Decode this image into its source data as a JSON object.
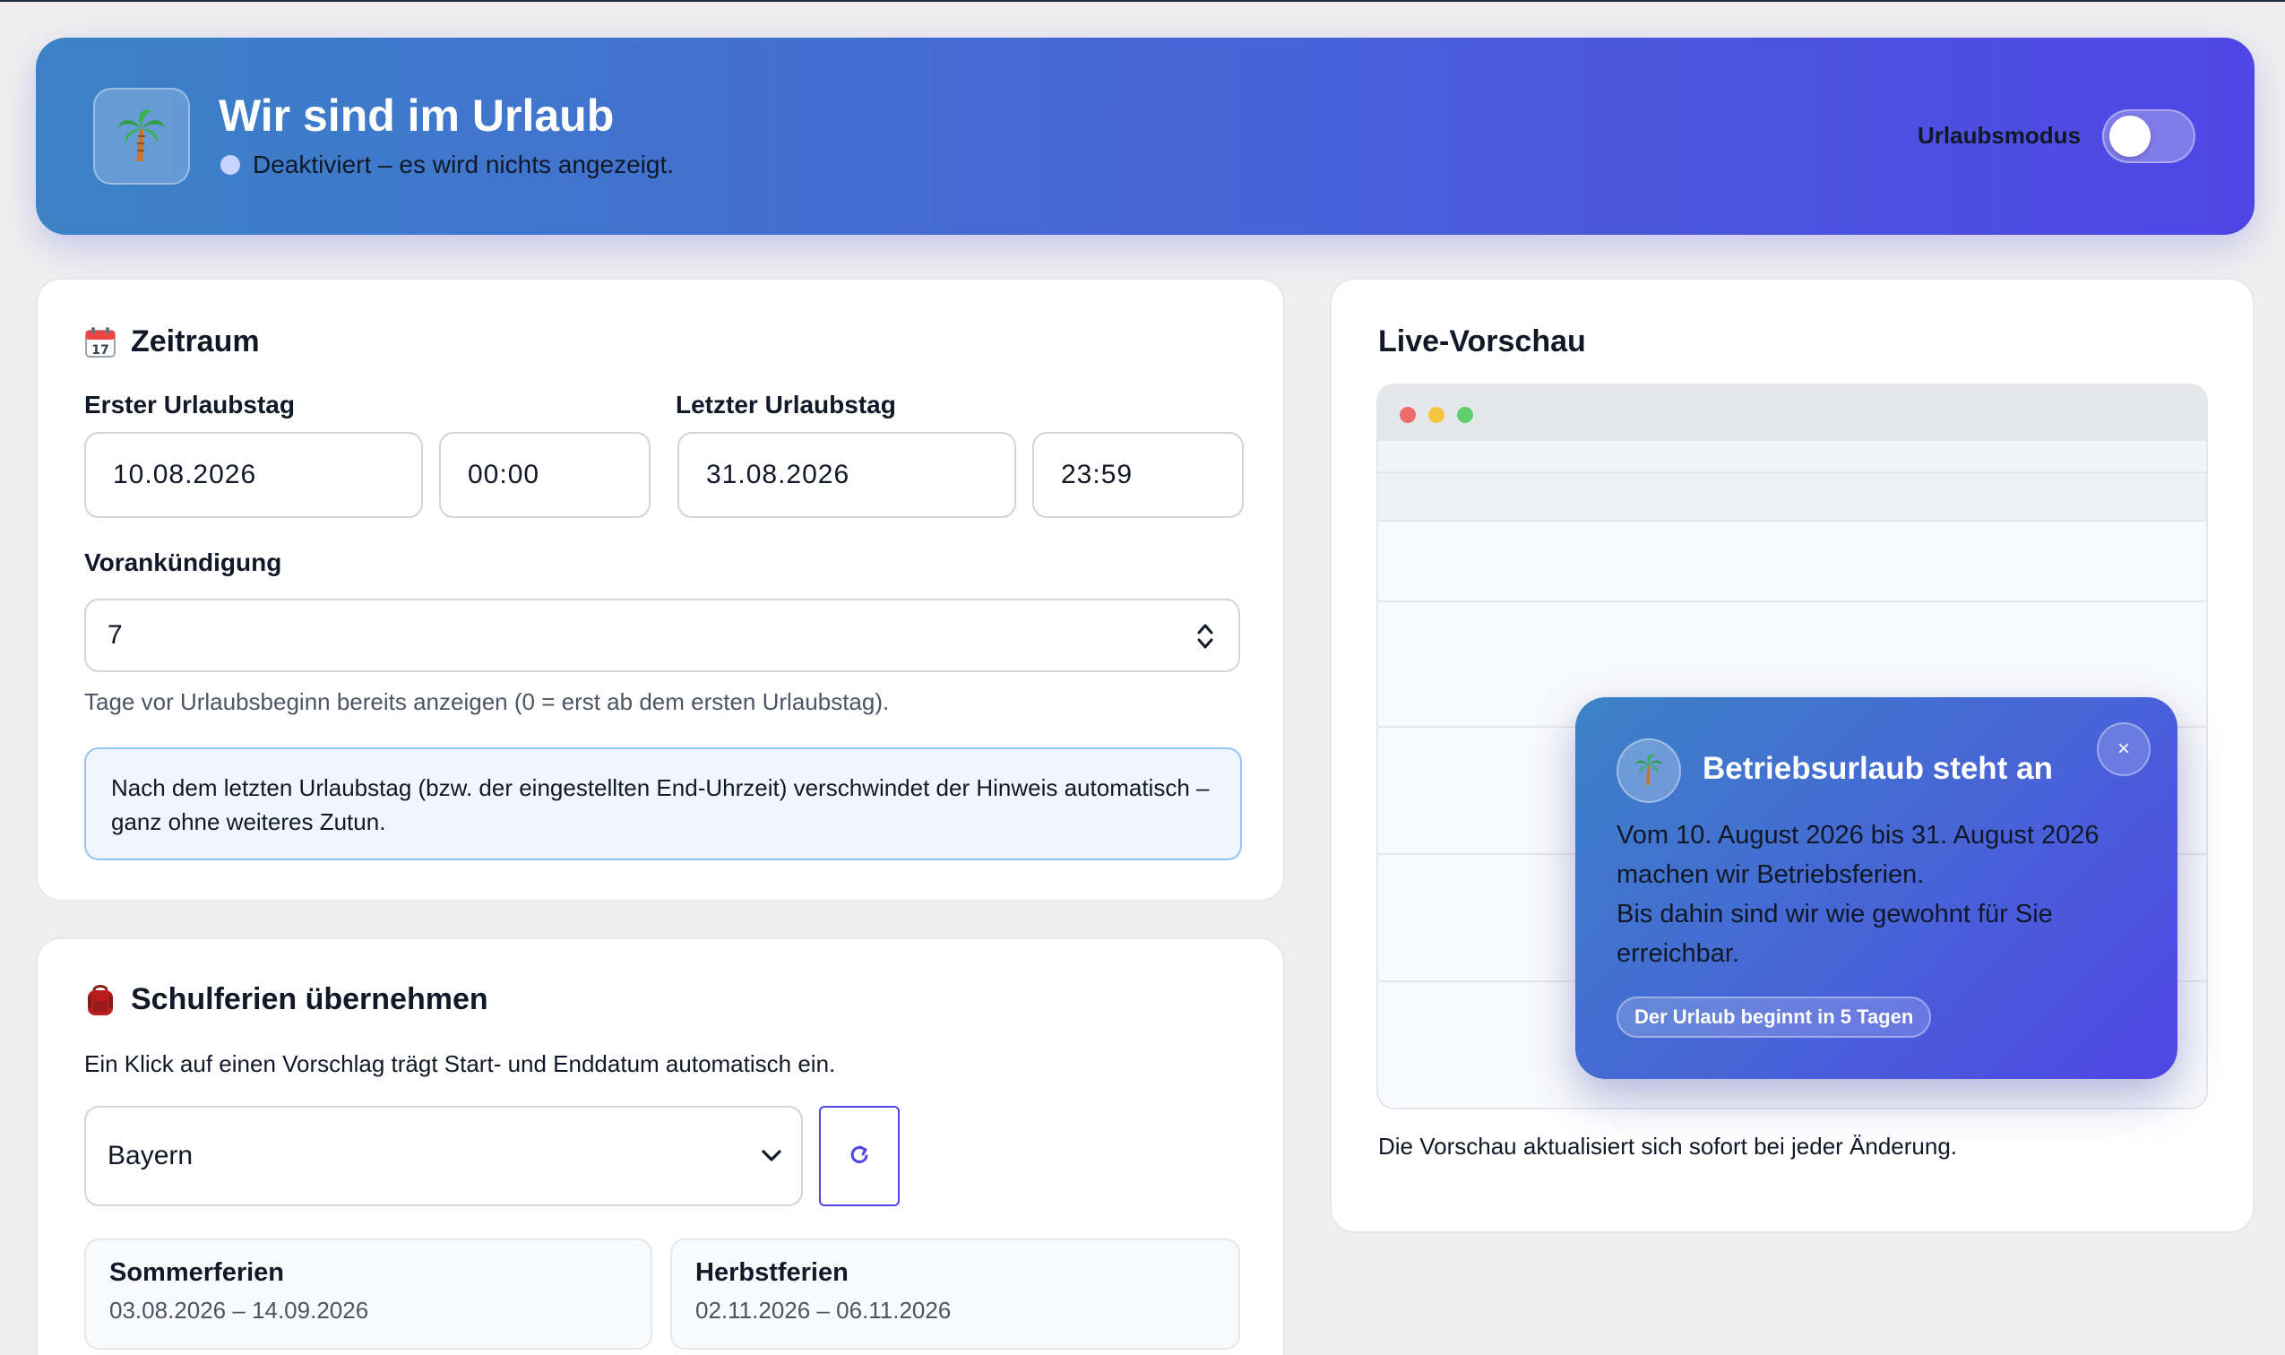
{
  "header": {
    "title": "Wir sind im Urlaub",
    "status": "Deaktiviert – es wird nichts angezeigt.",
    "toggle_label": "Urlaubsmodus",
    "toggle_on": false,
    "logo_icon": "palm-tree-icon"
  },
  "period": {
    "title": "Zeitraum",
    "icon": "calendar-icon",
    "first_day_label": "Erster Urlaubstag",
    "first_day_date": "10.08.2026",
    "first_day_time": "00:00",
    "last_day_label": "Letzter Urlaubstag",
    "last_day_date": "31.08.2026",
    "last_day_time": "23:59",
    "notice_label": "Vorankündigung",
    "notice_value": "7",
    "notice_hint": "Tage vor Urlaubsbeginn bereits anzeigen (0 = erst ab dem ersten Urlaubstag).",
    "info_text": "Nach dem letzten Urlaubstag (bzw. der eingestellten End-Uhrzeit) verschwindet der Hinweis automatisch – ganz ohne weiteres Zutun."
  },
  "school": {
    "title": "Schulferien übernehmen",
    "icon": "school-bag-icon",
    "description": "Ein Klick auf einen Vorschlag trägt Start- und Enddatum automatisch ein.",
    "state_selected": "Bayern",
    "holidays": [
      {
        "name": "Sommerferien",
        "range": "03.08.2026 – 14.09.2026"
      },
      {
        "name": "Herbstferien",
        "range": "02.11.2026 – 06.11.2026"
      }
    ]
  },
  "preview": {
    "title": "Live-Vorschau",
    "popup_title": "Betriebsurlaub steht an",
    "popup_body_1": "Vom 10. August 2026 bis 31. August 2026 machen wir Betriebsferien.",
    "popup_body_2": "Bis dahin sind wir wie gewohnt für Sie erreichbar.",
    "popup_badge": "Der Urlaub beginnt in 5 Tagen",
    "close_symbol": "×",
    "footer": "Die Vorschau aktualisiert sich sofort bei jeder Änderung."
  },
  "colors": {
    "accent": "#4f46e5",
    "header_start": "#3b82c6",
    "header_end": "#4f46e5",
    "info_bg": "#eff6ff",
    "info_border": "#93c5fd"
  }
}
